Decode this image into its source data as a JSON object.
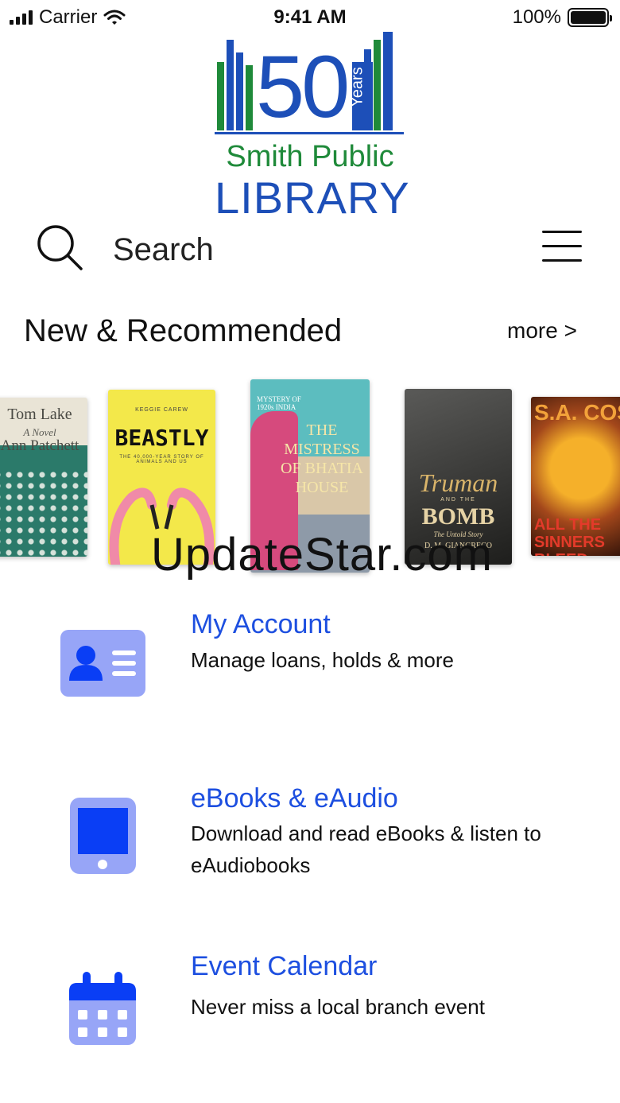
{
  "status_bar": {
    "carrier": "Carrier",
    "time": "9:41 AM",
    "battery": "100%"
  },
  "logo": {
    "number": "50",
    "years": "Years",
    "line1": "Smith Public",
    "line2": "LIBRARY",
    "green": "#1f8a3a",
    "blue": "#1d4fb8"
  },
  "search": {
    "label": "Search",
    "icon": "search-icon",
    "menu_icon": "hamburger-menu-icon"
  },
  "recommended": {
    "title": "New & Recommended",
    "more": "more >",
    "books": [
      {
        "title": "Tom Lake",
        "subtitle": "A Novel",
        "author": "Ann Patchett"
      },
      {
        "title": "BEASTLY",
        "author": "KEGGIE CAREW",
        "subtitle": "THE 40,000-YEAR STORY OF ANIMALS AND US"
      },
      {
        "title": "THE MISTRESS OF BHATIA HOUSE",
        "subtitle": "MYSTERY OF 1920s INDIA"
      },
      {
        "title": "Truman",
        "title2": "BOMB",
        "connector": "AND THE",
        "subtitle": "The Untold Story",
        "author": "D. M. GIANGRECO"
      },
      {
        "title": "ALL THE SINNERS BLEED",
        "author": "S.A. COSBY"
      }
    ]
  },
  "watermark": "UpdateStar.com",
  "menu": [
    {
      "title": "My Account",
      "description": "Manage loans, holds & more",
      "icon": "account-card-icon"
    },
    {
      "title": "eBooks & eAudio",
      "description": "Download and read eBooks & listen to eAudiobooks",
      "icon": "tablet-icon"
    },
    {
      "title": "Event Calendar",
      "description": "Never miss a local branch event",
      "icon": "calendar-icon"
    }
  ],
  "colors": {
    "accent": "#1d4fe0",
    "icon_light": "#97a5f7",
    "icon_dark": "#0a3ef5"
  }
}
